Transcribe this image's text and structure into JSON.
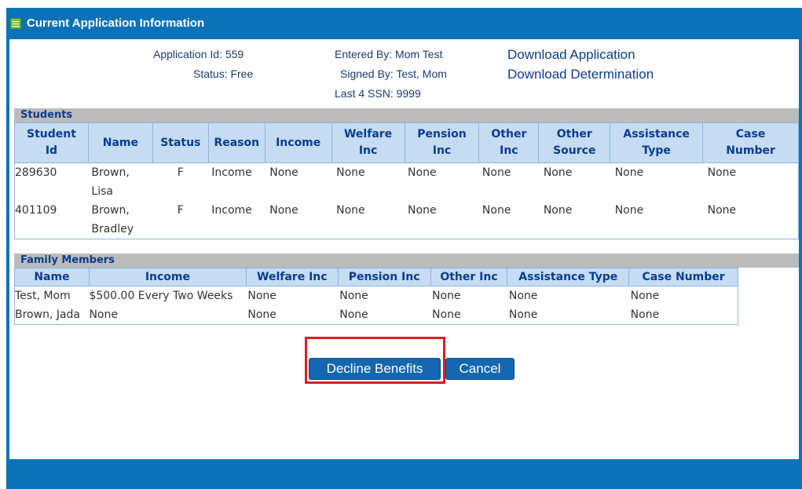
{
  "window": {
    "title": "Current Application Information"
  },
  "application": {
    "id_text": "Application Id: 559",
    "status_text": "Status: Free",
    "entered_by_text": "Entered By: Mom Test",
    "signed_by_text": "Signed By: Test, Mom",
    "ssn_text": "Last 4 SSN: 9999"
  },
  "links": {
    "download_application": "Download Application",
    "download_determination": "Download Determination"
  },
  "students": {
    "section_label": "Students",
    "headers": [
      [
        "Student",
        "Id"
      ],
      [
        "Name"
      ],
      [
        "Status"
      ],
      [
        "Reason"
      ],
      [
        "Income"
      ],
      [
        "Welfare",
        "Inc"
      ],
      [
        "Pension",
        "Inc"
      ],
      [
        "Other",
        "Inc"
      ],
      [
        "Other",
        "Source"
      ],
      [
        "Assistance",
        "Type"
      ],
      [
        "Case",
        "Number"
      ]
    ],
    "rows": [
      [
        "289630",
        "Brown, Lisa",
        "F",
        "Income",
        "None",
        "None",
        "None",
        "None",
        "None",
        "None",
        "None"
      ],
      [
        "401109",
        "Brown, Bradley",
        "F",
        "Income",
        "None",
        "None",
        "None",
        "None",
        "None",
        "None",
        "None"
      ]
    ]
  },
  "family": {
    "section_label": "Family Members",
    "headers": [
      "Name",
      "Income",
      "Welfare Inc",
      "Pension Inc",
      "Other Inc",
      "Assistance Type",
      "Case Number"
    ],
    "rows": [
      [
        "Test, Mom",
        "$500.00 Every Two Weeks",
        "None",
        "None",
        "None",
        "None",
        "None"
      ],
      [
        "Brown, Jada",
        "None",
        "None",
        "None",
        "None",
        "None",
        "None"
      ]
    ]
  },
  "buttons": {
    "decline": "Decline Benefits",
    "cancel": "Cancel"
  },
  "colors": {
    "frame": "#0b72b9",
    "header_bg": "#c5dcf3",
    "section_bg": "#bcbcbc",
    "button": "#1466b0",
    "highlight": "#e01b24"
  },
  "icons": {
    "title_icon": "form-icon"
  }
}
